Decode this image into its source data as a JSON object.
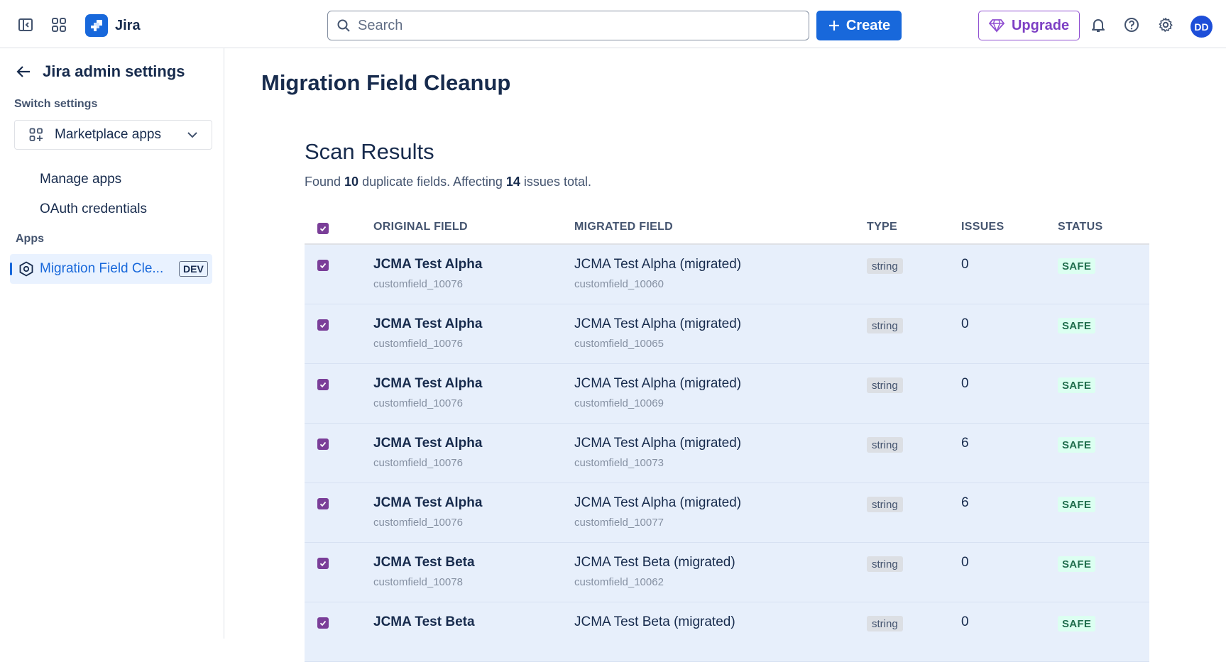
{
  "topbar": {
    "app_name": "Jira",
    "search_placeholder": "Search",
    "create_label": "Create",
    "upgrade_label": "Upgrade",
    "avatar_initials": "DD"
  },
  "sidebar": {
    "title": "Jira admin settings",
    "switch_label": "Switch settings",
    "dropdown_value": "Marketplace apps",
    "nav_items": [
      {
        "label": "Manage apps"
      },
      {
        "label": "OAuth credentials"
      }
    ],
    "apps_label": "Apps",
    "active_app": {
      "label": "Migration Field Cle...",
      "badge": "DEV"
    }
  },
  "main": {
    "page_title": "Migration Field Cleanup",
    "section_title": "Scan Results",
    "summary": {
      "found_prefix": "Found ",
      "duplicates": "10",
      "duplicates_suffix": " duplicate fields. Affecting ",
      "issues_total": "14",
      "issues_suffix": " issues total."
    },
    "table": {
      "headers": {
        "original": "ORIGINAL FIELD",
        "migrated": "MIGRATED FIELD",
        "type": "TYPE",
        "issues": "ISSUES",
        "status": "STATUS"
      },
      "rows": [
        {
          "orig_name": "JCMA Test Alpha",
          "orig_id": "customfield_10076",
          "mig_name": "JCMA Test Alpha (migrated)",
          "mig_id": "customfield_10060",
          "type": "string",
          "issues": "0",
          "status": "SAFE"
        },
        {
          "orig_name": "JCMA Test Alpha",
          "orig_id": "customfield_10076",
          "mig_name": "JCMA Test Alpha (migrated)",
          "mig_id": "customfield_10065",
          "type": "string",
          "issues": "0",
          "status": "SAFE"
        },
        {
          "orig_name": "JCMA Test Alpha",
          "orig_id": "customfield_10076",
          "mig_name": "JCMA Test Alpha (migrated)",
          "mig_id": "customfield_10069",
          "type": "string",
          "issues": "0",
          "status": "SAFE"
        },
        {
          "orig_name": "JCMA Test Alpha",
          "orig_id": "customfield_10076",
          "mig_name": "JCMA Test Alpha (migrated)",
          "mig_id": "customfield_10073",
          "type": "string",
          "issues": "6",
          "status": "SAFE"
        },
        {
          "orig_name": "JCMA Test Alpha",
          "orig_id": "customfield_10076",
          "mig_name": "JCMA Test Alpha (migrated)",
          "mig_id": "customfield_10077",
          "type": "string",
          "issues": "6",
          "status": "SAFE"
        },
        {
          "orig_name": "JCMA Test Beta",
          "orig_id": "customfield_10078",
          "mig_name": "JCMA Test Beta (migrated)",
          "mig_id": "customfield_10062",
          "type": "string",
          "issues": "0",
          "status": "SAFE"
        },
        {
          "orig_name": "JCMA Test Beta",
          "orig_id": "",
          "mig_name": "JCMA Test Beta (migrated)",
          "mig_id": "",
          "type": "string",
          "issues": "0",
          "status": "SAFE"
        }
      ]
    }
  }
}
